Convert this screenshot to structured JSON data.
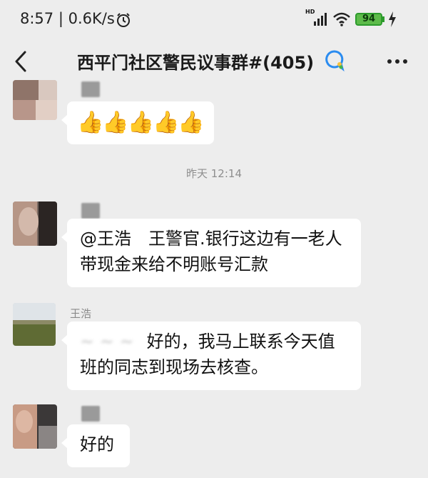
{
  "status_bar": {
    "time": "8:57 | 0.6K/s",
    "hd_label": "HD",
    "battery_level": "94"
  },
  "nav": {
    "title": "西平门社区警民议事群#(405)"
  },
  "messages": [
    {
      "type": "emoji",
      "emoji": "👍👍👍👍👍"
    },
    {
      "type": "timestamp",
      "text": "昨天 12:14"
    },
    {
      "type": "text",
      "text_line1": "@王浩　王警官.银行这边有一老人",
      "text_line2": "带现金来给不明账号汇款"
    },
    {
      "type": "text",
      "sender": "王浩",
      "blurred_prefix": "~ ~ ~",
      "text_line1": "好的，我马上联系今天值",
      "text_line2": "班的同志到现场去核查。"
    },
    {
      "type": "text",
      "text_line1": "好的"
    }
  ]
}
